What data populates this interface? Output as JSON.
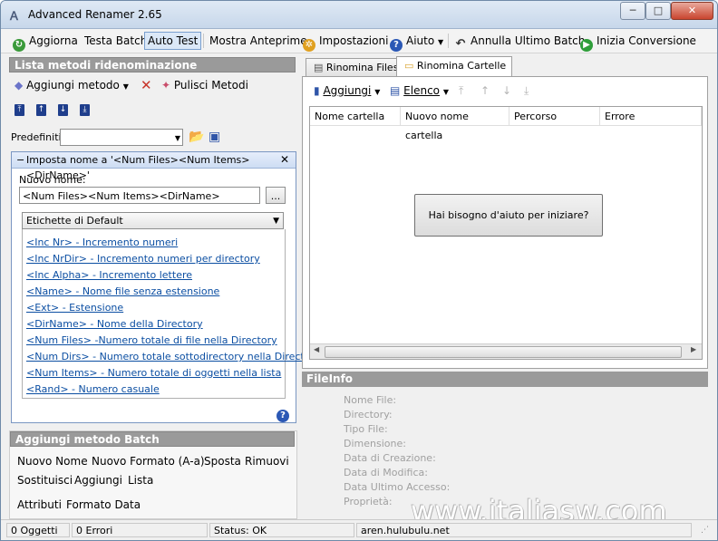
{
  "window": {
    "title": "Advanced Renamer 2.65",
    "app_icon": "AR-logo"
  },
  "window_buttons": {
    "minimize": "─",
    "maximize": "□",
    "close": "✕"
  },
  "toolbar": {
    "refresh": "Aggiorna",
    "test_batch": "Testa Batch",
    "auto_test": "Auto Test",
    "preview": "Mostra Anteprime",
    "settings": "Impostazioni",
    "help": "Aiuto",
    "undo_batch": "Annulla Ultimo Batch",
    "start": "Inizia Conversione"
  },
  "left": {
    "methods_header": "Lista metodi ridenominazione",
    "add_method": "Aggiungi metodo",
    "clear_methods": "Pulisci Metodi",
    "presets_label": "Predefiniti:",
    "method_title": "Imposta nome a '<Num Files><Num Items><DirName>'",
    "new_name_label": "Nuovo nome:",
    "new_name_value": "<Num Files><Num Items><DirName>",
    "browse_button": "...",
    "tags_dropdown": "Etichette di Default",
    "tags": [
      "<Inc Nr> - Incremento numeri",
      "<Inc NrDir> - Incremento numeri per directory",
      "<Inc Alpha> - Incremento lettere",
      "<Name> - Nome file senza estensione",
      "<Ext> - Estensione",
      "<DirName> - Nome della Directory",
      "<Num Files> -Numero totale di file nella Directory",
      "<Num Dirs> - Numero totale sottodirectory nella Directory",
      "<Num Items> - Numero totale di oggetti nella lista",
      "<Rand> - Numero casuale"
    ],
    "batch_header": "Aggiungi metodo Batch",
    "batch_row1": [
      "Nuovo Nome",
      "Nuovo Formato (A-a)",
      "Sposta",
      "Rimuovi"
    ],
    "batch_row2": [
      "Sostituisci",
      "Aggiungi",
      "Lista"
    ],
    "batch_row3": [
      "Attributi",
      "Formato Data"
    ]
  },
  "right": {
    "tab_files": "Rinomina Files",
    "tab_folders": "Rinomina Cartelle",
    "add_btn": "Aggiungi",
    "list_btn": "Elenco",
    "columns": [
      "Nome cartella",
      "Nuovo nome cartella",
      "Percorso",
      "Errore"
    ],
    "help_button": "Hai bisogno d'aiuto per iniziare?",
    "fileinfo_header": "FileInfo",
    "fileinfo_labels": [
      "Nome File:",
      "Directory:",
      "Tipo File:",
      "Dimensione:",
      "Data di Creazione:",
      "Data di Modifica:",
      "Data Ultimo Accesso:",
      "Proprietà:"
    ]
  },
  "watermark": "www.italiasw.com",
  "status": {
    "objects": "0 Oggetti",
    "errors": "0 Errori",
    "state": "Status: OK",
    "site": "aren.hulubulu.net"
  }
}
